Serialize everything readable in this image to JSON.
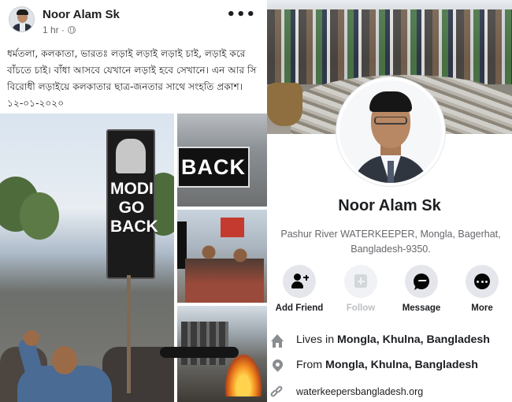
{
  "post": {
    "author": "Noor Alam Sk",
    "time": "1 hr ·",
    "more_icon": "more-dots-icon",
    "text": "ধর্মতলা, কলকাতা, ভারতঃ লড়াই লড়াই লড়াই চাই, লড়াই করে বাঁচতে চাই। বাঁধা আসবে যেখানে লড়াই হবে সেখানে। এন আর সি বিরোধী লড়াইয়ে কলকাতার ছাত্র-জনতার সাথে সংহতি প্রকাশ। ১২-০১-২০২০",
    "photos": {
      "main_sign": "MODI GO BACK",
      "banner_back": "BACK"
    }
  },
  "profile": {
    "name": "Noor Alam Sk",
    "bio": "Pashur River WATERKEEPER, Mongla, Bagerhat, Bangladesh-9350.",
    "actions": [
      {
        "label": "Add Friend",
        "icon": "add-friend-icon",
        "enabled": true
      },
      {
        "label": "Follow",
        "icon": "follow-icon",
        "enabled": false
      },
      {
        "label": "Message",
        "icon": "messenger-icon",
        "enabled": true
      },
      {
        "label": "More",
        "icon": "more-icon",
        "enabled": true
      }
    ],
    "lives_prefix": "Lives in ",
    "lives_place": "Mongla, Khulna, Bangladesh",
    "from_prefix": "From ",
    "from_place": "Mongla, Khulna, Bangladesh",
    "website": "waterkeepersbangladesh.org"
  },
  "colors": {
    "text_primary": "#1c1e21",
    "text_secondary": "#65676b",
    "button_bg": "#e4e6eb",
    "icon_gray": "#8a8d91"
  }
}
